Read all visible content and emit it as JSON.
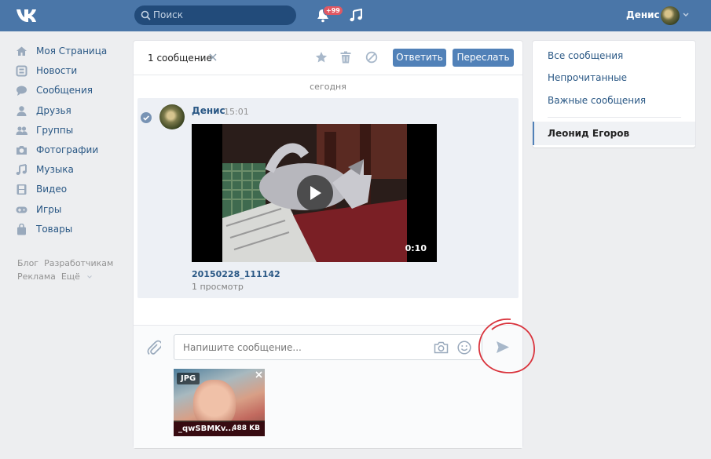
{
  "header": {
    "search_placeholder": "Поиск",
    "notifications_badge": "+99",
    "user_name": "Денис"
  },
  "sidebar": {
    "items": [
      {
        "label": "Моя Страница",
        "icon": "home-icon"
      },
      {
        "label": "Новости",
        "icon": "news-icon"
      },
      {
        "label": "Сообщения",
        "icon": "messages-icon"
      },
      {
        "label": "Друзья",
        "icon": "friend-icon"
      },
      {
        "label": "Группы",
        "icon": "groups-icon"
      },
      {
        "label": "Фотографии",
        "icon": "camera-icon"
      },
      {
        "label": "Музыка",
        "icon": "music-icon"
      },
      {
        "label": "Видео",
        "icon": "video-icon"
      },
      {
        "label": "Игры",
        "icon": "gamepad-icon"
      },
      {
        "label": "Товары",
        "icon": "bag-icon"
      }
    ],
    "footer_links": [
      "Блог",
      "Разработчикам",
      "Реклама",
      "Ещё"
    ]
  },
  "conversation": {
    "selected_count": "1 сообщение",
    "reply_label": "Ответить",
    "forward_label": "Переслать",
    "day_separator": "сегодня",
    "message": {
      "author": "Денис",
      "time": "15:01",
      "video": {
        "duration": "0:10",
        "title": "20150228_111142",
        "views": "1 просмотр"
      }
    },
    "composer": {
      "placeholder": "Напишите сообщение..."
    },
    "attachment": {
      "type": "JPG",
      "file_name": "_qwSBMKv...",
      "file_size": "488 KB"
    }
  },
  "right_menu": {
    "items": [
      "Все сообщения",
      "Непрочитанные",
      "Важные сообщения"
    ],
    "selected_dialog": "Леонид Егоров"
  },
  "colors": {
    "header_bg": "#4a76a8",
    "link": "#2a5885",
    "button": "#5181b8",
    "annotation_circle": "#d9323b"
  }
}
